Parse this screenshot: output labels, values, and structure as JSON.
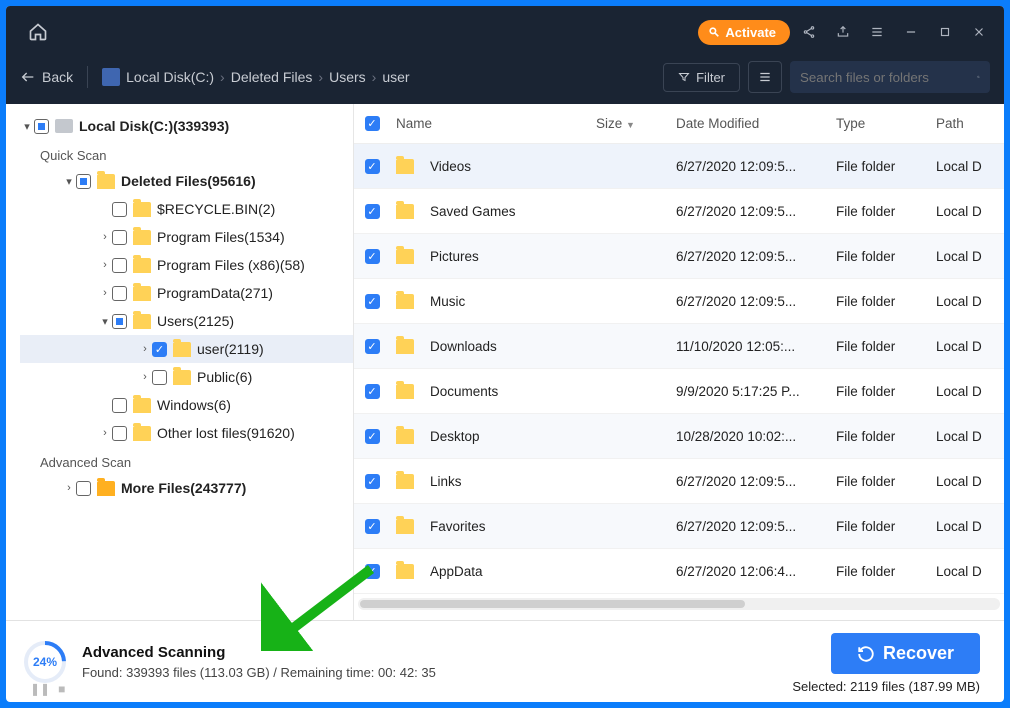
{
  "titlebar": {
    "activate": "Activate"
  },
  "toolbar": {
    "back": "Back",
    "breadcrumbs": [
      "Local Disk(C:)",
      "Deleted Files",
      "Users",
      "user"
    ],
    "filter": "Filter",
    "search_placeholder": "Search files or folders"
  },
  "tree": {
    "root": "Local Disk(C:)(339393)",
    "quick_scan": "Quick Scan",
    "deleted_files": "Deleted Files(95616)",
    "nodes": [
      {
        "label": "$RECYCLE.BIN(2)"
      },
      {
        "label": "Program Files(1534)"
      },
      {
        "label": "Program Files (x86)(58)"
      },
      {
        "label": "ProgramData(271)"
      },
      {
        "label": "Users(2125)"
      },
      {
        "label": "user(2119)"
      },
      {
        "label": "Public(6)"
      },
      {
        "label": "Windows(6)"
      },
      {
        "label": "Other lost files(91620)"
      }
    ],
    "advanced_scan": "Advanced Scan",
    "more_files": "More Files(243777)"
  },
  "columns": {
    "name": "Name",
    "size": "Size",
    "date": "Date Modified",
    "type": "Type",
    "path": "Path"
  },
  "files": [
    {
      "name": "Videos",
      "date": "6/27/2020 12:09:5...",
      "type": "File folder",
      "path": "Local D"
    },
    {
      "name": "Saved Games",
      "date": "6/27/2020 12:09:5...",
      "type": "File folder",
      "path": "Local D"
    },
    {
      "name": "Pictures",
      "date": "6/27/2020 12:09:5...",
      "type": "File folder",
      "path": "Local D"
    },
    {
      "name": "Music",
      "date": "6/27/2020 12:09:5...",
      "type": "File folder",
      "path": "Local D"
    },
    {
      "name": "Downloads",
      "date": "11/10/2020 12:05:...",
      "type": "File folder",
      "path": "Local D"
    },
    {
      "name": "Documents",
      "date": "9/9/2020 5:17:25 P...",
      "type": "File folder",
      "path": "Local D"
    },
    {
      "name": "Desktop",
      "date": "10/28/2020 10:02:...",
      "type": "File folder",
      "path": "Local D"
    },
    {
      "name": "Links",
      "date": "6/27/2020 12:09:5...",
      "type": "File folder",
      "path": "Local D"
    },
    {
      "name": "Favorites",
      "date": "6/27/2020 12:09:5...",
      "type": "File folder",
      "path": "Local D"
    },
    {
      "name": "AppData",
      "date": "6/27/2020 12:06:4...",
      "type": "File folder",
      "path": "Local D"
    }
  ],
  "footer": {
    "percent": "24%",
    "title": "Advanced Scanning",
    "found": "Found: 339393 files (113.03 GB) / Remaining time: 00: 42: 35",
    "recover": "Recover",
    "selected": "Selected: 2119 files (187.99 MB)"
  }
}
